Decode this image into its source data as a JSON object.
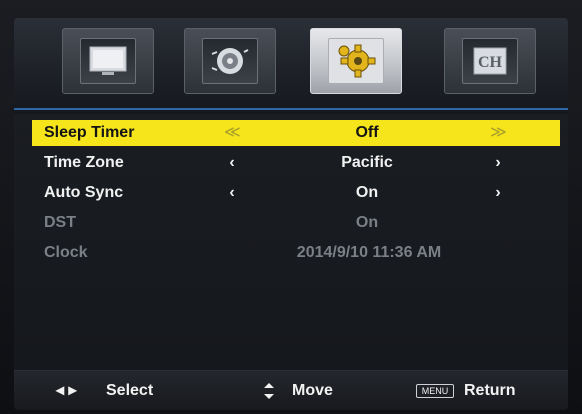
{
  "tabs": [
    {
      "icon": "monitor-icon",
      "active": false
    },
    {
      "icon": "speaker-icon",
      "active": false
    },
    {
      "icon": "gear-icon",
      "active": true
    },
    {
      "icon": "lock-icon",
      "active": false
    }
  ],
  "tab_lock_text": "CH",
  "settings": [
    {
      "label": "Sleep Timer",
      "value": "Off",
      "left_arrow": "≪",
      "right_arrow": "≫",
      "state": "selected"
    },
    {
      "label": "Time Zone",
      "value": "Pacific",
      "left_arrow": "‹",
      "right_arrow": "›",
      "state": "normal"
    },
    {
      "label": "Auto Sync",
      "value": "On",
      "left_arrow": "‹",
      "right_arrow": "›",
      "state": "normal"
    },
    {
      "label": "DST",
      "value": "On",
      "state": "disabled"
    },
    {
      "label": "Clock",
      "value": "2014/9/10 11:36 AM",
      "state": "disabled"
    }
  ],
  "footer": {
    "select_arrows": "◂ ▸",
    "select_label": "Select",
    "move_label": "Move",
    "menu_key": "MENU",
    "return_label": "Return"
  },
  "colors": {
    "highlight": "#f5e51a",
    "accent": "#2e66a7"
  }
}
